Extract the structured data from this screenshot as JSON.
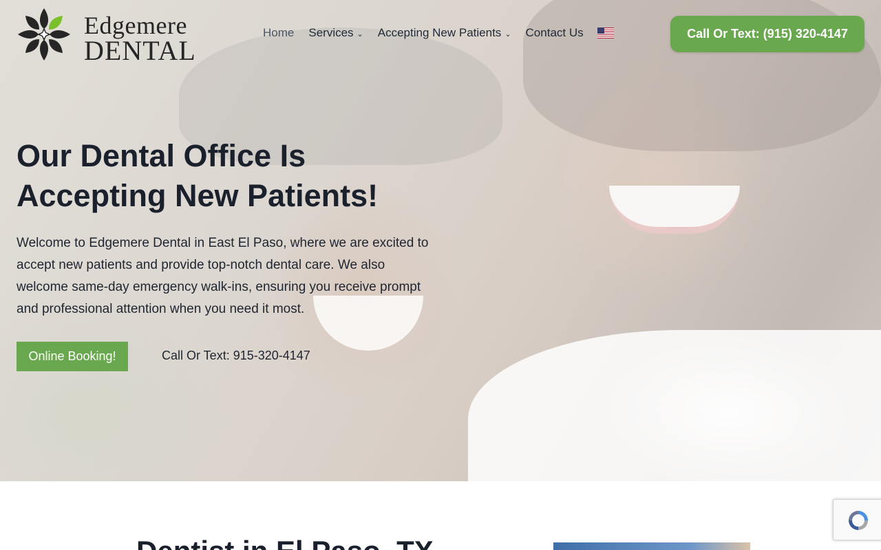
{
  "logo": {
    "line1": "Edgemere",
    "line2": "DENTAL"
  },
  "nav": {
    "items": [
      {
        "label": "Home",
        "has_dropdown": false
      },
      {
        "label": "Services",
        "has_dropdown": true
      },
      {
        "label": "Accepting New Patients",
        "has_dropdown": true
      },
      {
        "label": "Contact Us",
        "has_dropdown": false
      }
    ],
    "language_icon": "us-flag-icon"
  },
  "header_cta": {
    "label": "Call Or Text: (915) 320-4147"
  },
  "hero": {
    "title_line1": "Our Dental Office Is",
    "title_line2": "Accepting New Patients!",
    "text": "Welcome to Edgemere Dental in East El Paso, where we are excited to accept new patients and provide top-notch dental care. We also welcome same-day emergency walk-ins, ensuring you receive prompt and professional attention when you need it most.",
    "booking_button": "Online Booking!",
    "call_link": "Call Or Text: 915-320-4147"
  },
  "section": {
    "title": "Dentist in El Paso, TX"
  },
  "colors": {
    "accent_green": "#6aa84f",
    "heading": "#1a202c",
    "logo_green": "#7bbf2a"
  },
  "widgets": {
    "recaptcha_icon": "recaptcha-icon"
  }
}
